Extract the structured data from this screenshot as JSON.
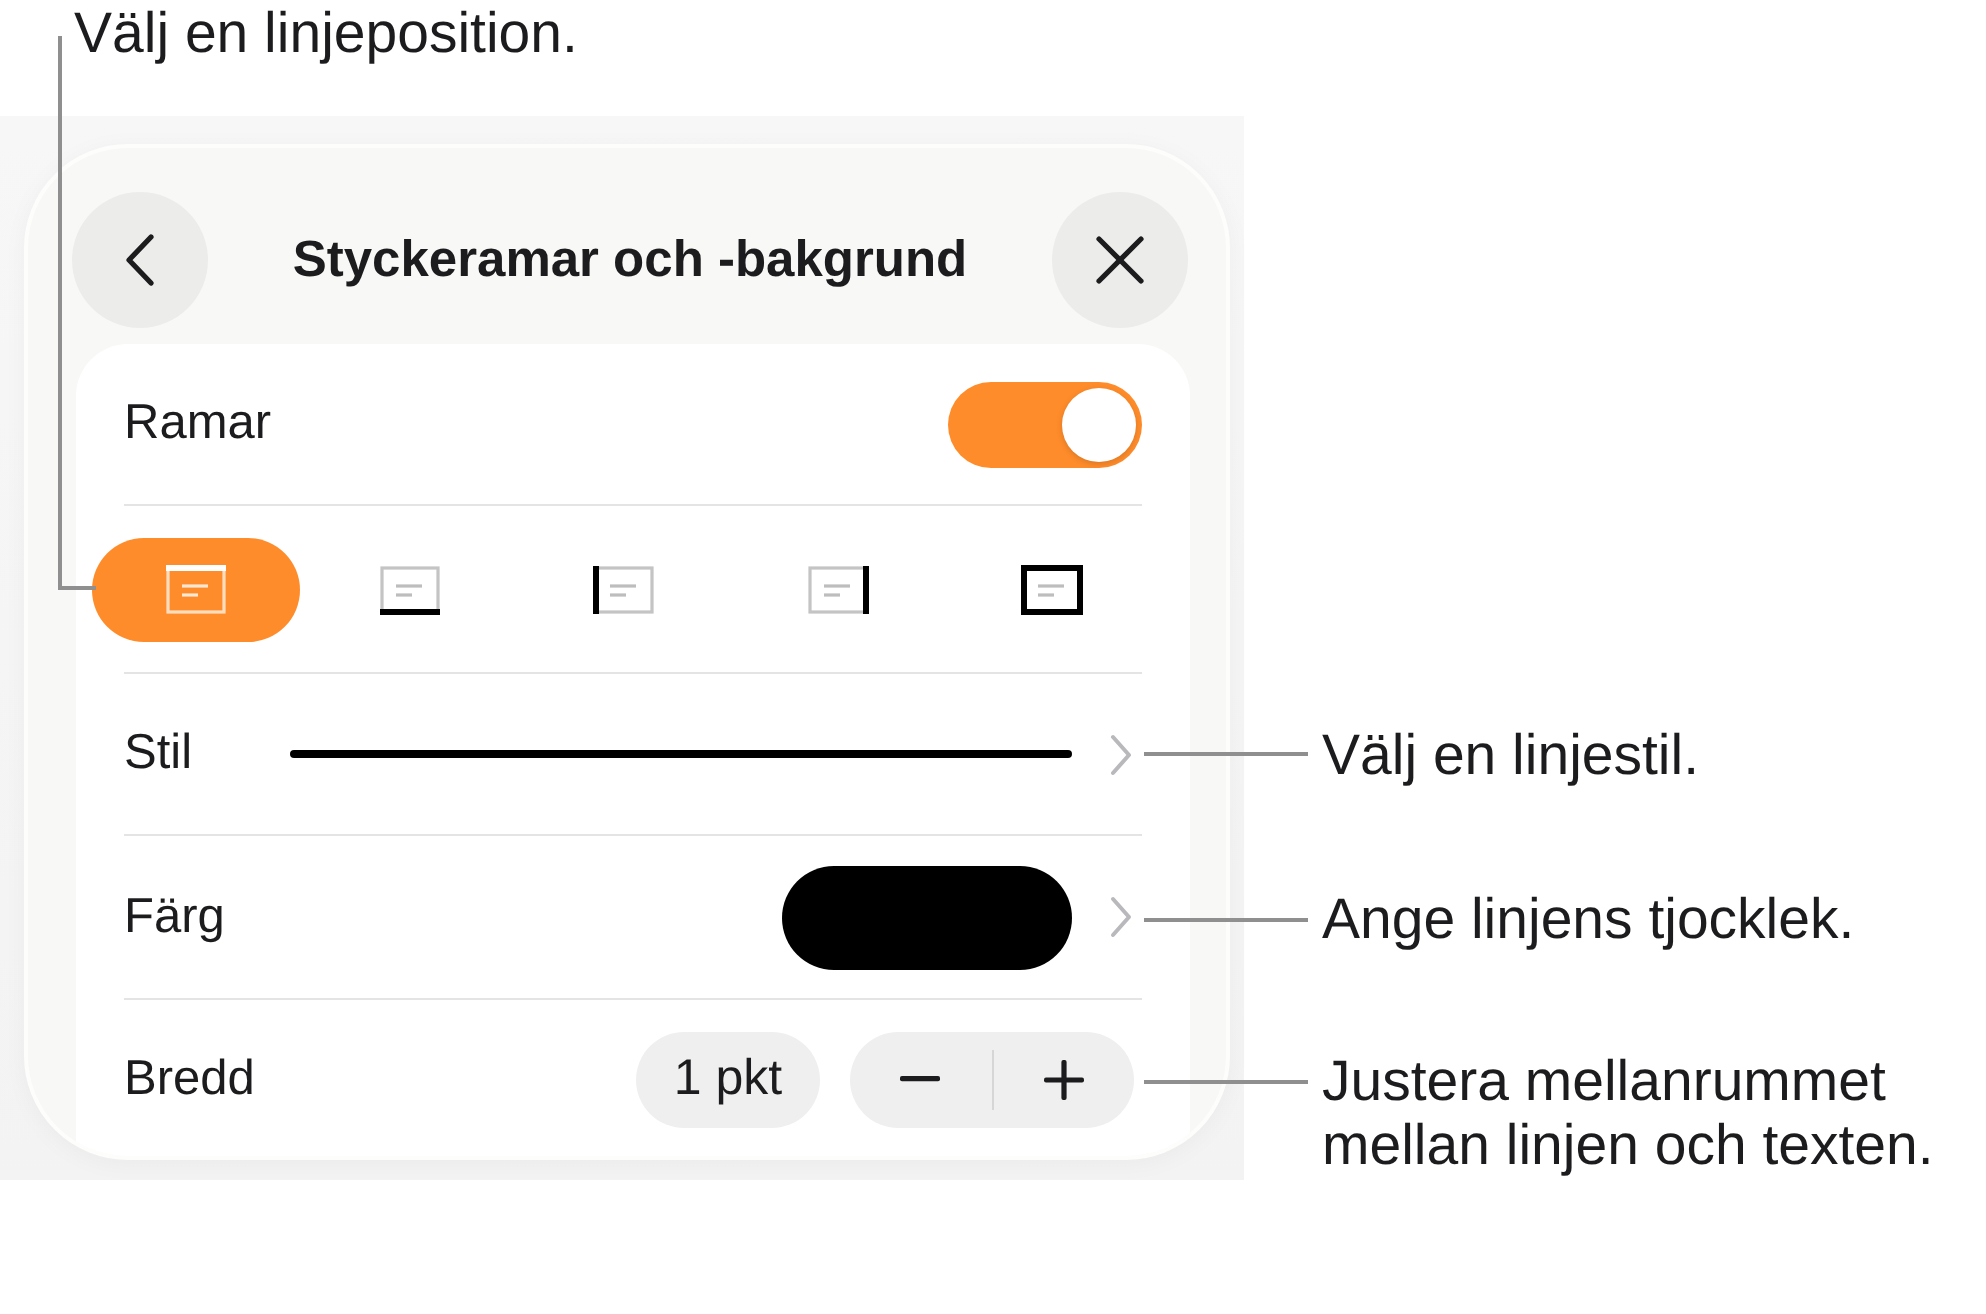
{
  "callouts": [
    {
      "kind": "elbow",
      "text": "Välj en linjeposition."
    },
    {
      "kind": "straight",
      "text": "Välj en linjestil."
    },
    {
      "kind": "straight",
      "text": "Ange linjens tjocklek."
    },
    {
      "kind": "straight",
      "text": "Justera mellanrummet mellan linjen och texten."
    }
  ],
  "popover": {
    "title": "Styckeramar och -bakgrund",
    "rows": [
      {
        "kind": "toggle",
        "label": "Ramar",
        "on": true
      },
      {
        "kind": "positions",
        "options": [
          {
            "selected": true
          },
          {
            "selected": false
          },
          {
            "selected": false
          },
          {
            "selected": false
          },
          {
            "selected": false
          }
        ]
      },
      {
        "kind": "style",
        "label": "Stil"
      },
      {
        "kind": "color",
        "label": "Färg",
        "color": "#000000"
      },
      {
        "kind": "stepper",
        "label": "Bredd",
        "value": "1 pkt"
      }
    ]
  }
}
